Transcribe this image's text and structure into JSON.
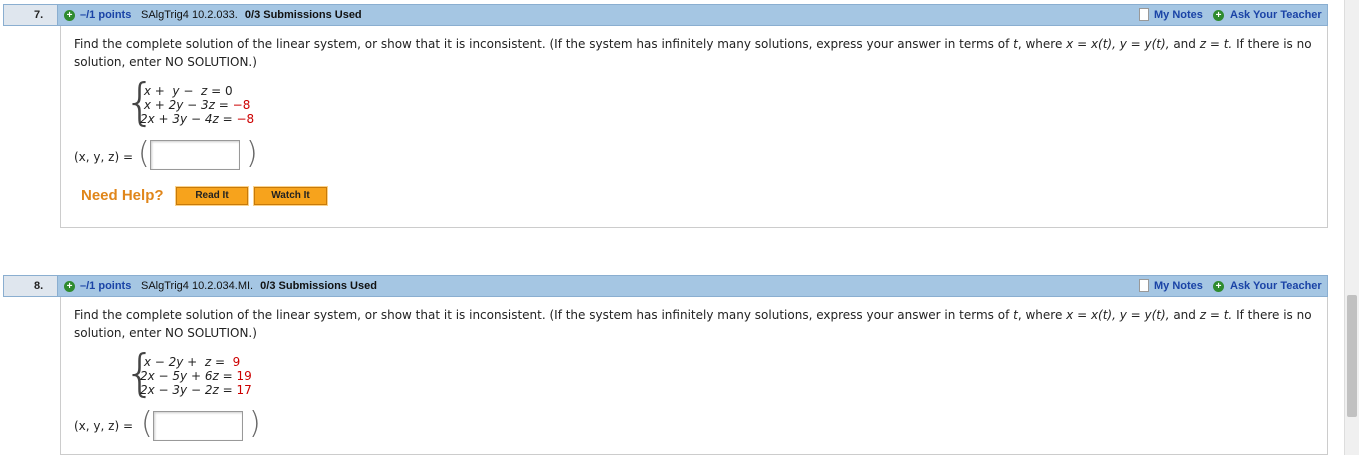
{
  "questions": [
    {
      "number": "7.",
      "points": "–/1 points",
      "source": "SAlgTrig4 10.2.033.",
      "submissions": "0/3 Submissions Used",
      "my_notes": "My Notes",
      "ask_teacher": "Ask Your Teacher",
      "prompt_line1_a": "Find the complete solution of the linear system, or show that it is inconsistent. (If the system has infinitely many solutions, express your answer in terms of ",
      "prompt_t": "t",
      "prompt_line1_b": ", where  ",
      "prompt_x": "x = x(t),   y = y(t),",
      "prompt_and": "  and  ",
      "prompt_z": "z = t.",
      "prompt_line1_c": "  If there is no",
      "prompt_line2": "solution, enter NO SOLUTION.)",
      "equations": [
        {
          "lhs": " x +  y −  z = ",
          "rhs": "0",
          "rhs_red": false
        },
        {
          "lhs": " x + 2y − 3z = ",
          "rhs": "−8",
          "rhs_red": true
        },
        {
          "lhs": "2x + 3y − 4z = ",
          "rhs": "−8",
          "rhs_red": true
        }
      ],
      "answer_label": "(x, y, z) =",
      "answer_value": "",
      "need_help": "Need Help?",
      "read_it": "Read It",
      "watch_it": "Watch It"
    },
    {
      "number": "8.",
      "points": "–/1 points",
      "source": "SAlgTrig4 10.2.034.MI.",
      "submissions": "0/3 Submissions Used",
      "my_notes": "My Notes",
      "ask_teacher": "Ask Your Teacher",
      "prompt_line1_a": "Find the complete solution of the linear system, or show that it is inconsistent. (If the system has infinitely many solutions, express your answer in terms of ",
      "prompt_t": "t",
      "prompt_line1_b": ", where  ",
      "prompt_x": "x = x(t),   y = y(t),",
      "prompt_and": "  and  ",
      "prompt_z": "z = t.",
      "prompt_line1_c": "  If there is no",
      "prompt_line2": "solution, enter NO SOLUTION.)",
      "equations": [
        {
          "lhs": " x − 2y +  z = ",
          "rhs": " 9",
          "rhs_red": true
        },
        {
          "lhs": "2x − 5y + 6z = ",
          "rhs": "19",
          "rhs_red": true
        },
        {
          "lhs": "2x − 3y − 2z = ",
          "rhs": "17",
          "rhs_red": true
        }
      ],
      "answer_label": "(x, y, z) =",
      "answer_value": ""
    }
  ],
  "colors": {
    "header_bar": "#a5c6e3",
    "points_link": "#1a43a6",
    "help_orange": "#e0861a",
    "button_orange": "#f7a31c",
    "constant_red": "#cc0000"
  },
  "icons": {
    "add": "plus-circle-icon",
    "notes": "document-icon"
  }
}
